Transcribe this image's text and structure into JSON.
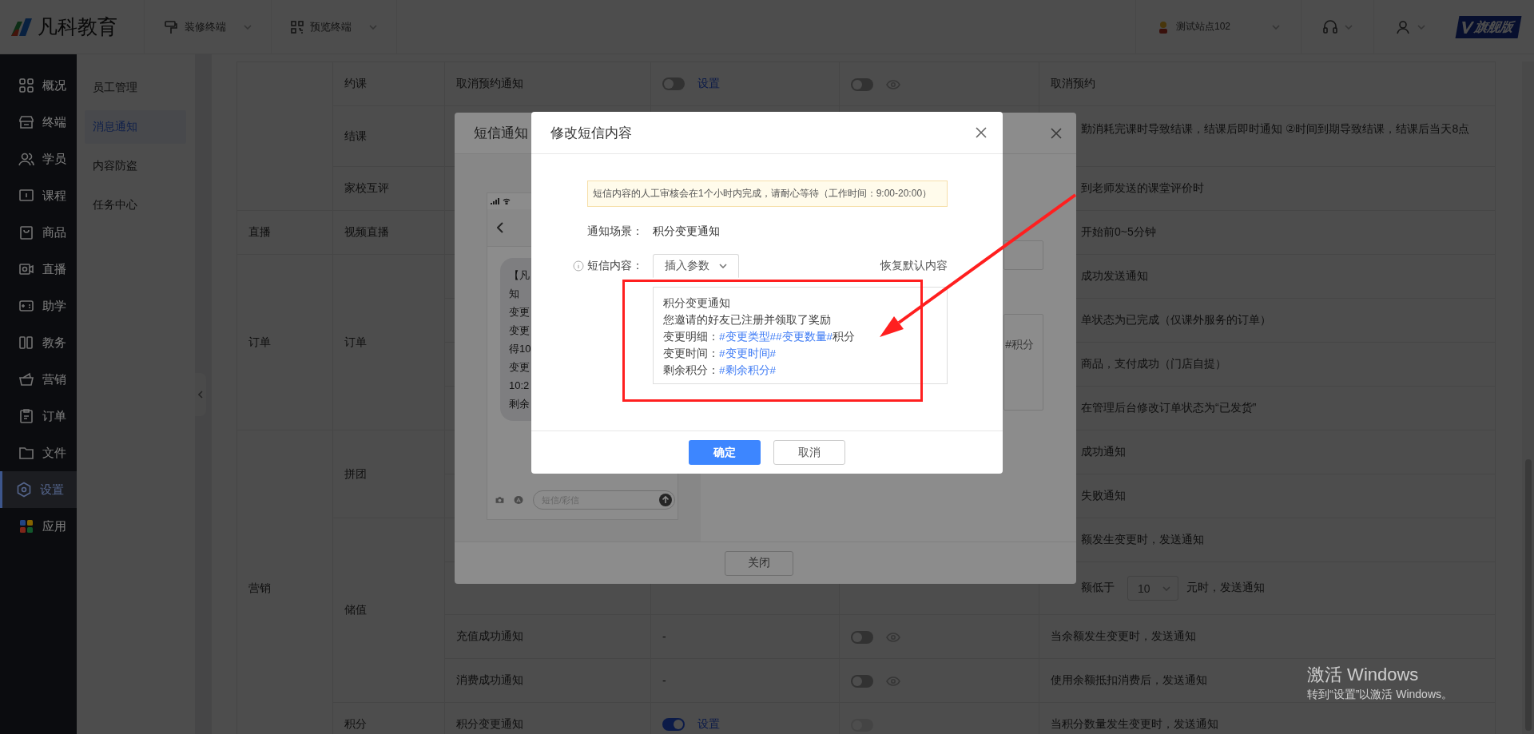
{
  "topbar": {
    "logo_text": "凡科教育",
    "menus": [
      {
        "label": "装修终端"
      },
      {
        "label": "预览终端"
      }
    ],
    "site": "测试站点102",
    "edition": "旗舰版"
  },
  "sidebar": {
    "items": [
      {
        "label": "概况",
        "selected": false
      },
      {
        "label": "终端",
        "selected": false
      },
      {
        "label": "学员",
        "selected": false
      },
      {
        "label": "课程",
        "selected": false
      },
      {
        "label": "商品",
        "selected": false
      },
      {
        "label": "直播",
        "selected": false
      },
      {
        "label": "助学",
        "selected": false
      },
      {
        "label": "教务",
        "selected": false
      },
      {
        "label": "营销",
        "selected": false
      },
      {
        "label": "订单",
        "selected": false
      },
      {
        "label": "文件",
        "selected": false
      },
      {
        "label": "设置",
        "selected": true
      },
      {
        "label": "应用",
        "selected": false
      }
    ]
  },
  "subnav": {
    "items": [
      {
        "label": "员工管理",
        "selected": false
      },
      {
        "label": "消息通知",
        "selected": true
      },
      {
        "label": "内容防盗",
        "selected": false
      },
      {
        "label": "任务中心",
        "selected": false
      }
    ]
  },
  "table": {
    "groups": [
      {
        "subgroups": [
          {
            "name": "约课",
            "rows": [
              {
                "name": "取消预约通知",
                "sms": {
                  "on": false,
                  "link": "设置"
                },
                "wechat": {
                  "on": false,
                  "preview": true
                },
                "description": [
                  {
                    "kind": "text",
                    "text": "取消预约"
                  }
                ]
              }
            ]
          },
          {
            "name": "结课",
            "rows": [
              {
                "description": [
                  {
                    "kind": "wrapped",
                    "text": "勤消耗完课时导致结课，结课后即时通知 ②时间到期导致结课，结课后当天8点"
                  }
                ]
              }
            ]
          },
          {
            "name": "家校互评",
            "rows": [
              {
                "description": [
                  {
                    "kind": "text",
                    "text": "到老师发送的课堂评价时"
                  }
                ]
              }
            ]
          }
        ]
      },
      {
        "category": "直播",
        "subgroups": [
          {
            "name": "视频直播",
            "rows": [
              {
                "description": [
                  {
                    "kind": "text",
                    "text": "开始前0~5分钟"
                  }
                ]
              }
            ]
          }
        ]
      },
      {
        "category": "订单",
        "subgroups": [
          {
            "name": "订单",
            "rows": [
              {
                "description": [
                  {
                    "kind": "text",
                    "text": "成功发送通知"
                  }
                ]
              },
              {
                "description": [
                  {
                    "kind": "text",
                    "text": "单状态为已完成（仅课外服务的订单）"
                  }
                ]
              },
              {
                "description": [
                  {
                    "kind": "text",
                    "text": "商品，支付成功（门店自提）"
                  }
                ]
              },
              {
                "description": [
                  {
                    "kind": "text",
                    "text": "在管理后台修改订单状态为“已发货”"
                  }
                ]
              }
            ]
          }
        ]
      },
      {
        "category": "营销",
        "subgroups": [
          {
            "name": "拼团",
            "rows": [
              {
                "description": [
                  {
                    "kind": "text",
                    "text": "成功通知"
                  }
                ]
              },
              {
                "description": [
                  {
                    "kind": "text",
                    "text": "失败通知"
                  }
                ]
              }
            ]
          },
          {
            "name": "储值",
            "rows": [
              {
                "description": [
                  {
                    "kind": "text",
                    "text": "额发生变更时，发送通知"
                  }
                ]
              },
              {
                "description": [
                  {
                    "kind": "text",
                    "text": "额低于"
                  },
                  {
                    "kind": "select",
                    "value": "10"
                  },
                  {
                    "kind": "text",
                    "text": "元时，发送通知"
                  }
                ]
              },
              {
                "name": "充值成功通知",
                "sms": {
                  "text": "-"
                },
                "wechat": {
                  "on": false,
                  "preview": true
                },
                "description": [
                  {
                    "kind": "text",
                    "text": "当余额发生变更时，发送通知"
                  }
                ]
              },
              {
                "name": "消费成功通知",
                "sms": {
                  "text": "-"
                },
                "wechat": {
                  "on": false,
                  "preview": true
                },
                "description": [
                  {
                    "kind": "text",
                    "text": "使用余额抵扣消费后，发送通知"
                  }
                ]
              }
            ]
          },
          {
            "name": "积分",
            "rows": [
              {
                "name": "积分变更通知",
                "sms": {
                  "on": true,
                  "link": "设置"
                },
                "wechat": {
                  "on": false,
                  "disabled": true
                },
                "description": [
                  {
                    "kind": "text",
                    "text": "当积分数量发生变更时，发送通知"
                  }
                ]
              }
            ]
          }
        ]
      }
    ]
  },
  "sms_settings_dialog": {
    "title": "短信通知",
    "preview_lines": [
      "【凡",
      "知",
      "变更",
      "变更",
      "得10",
      "变更",
      "10:2",
      "剩余"
    ],
    "input_placeholder": "短信/彩信",
    "content_fragment": "#积分",
    "close_button": "关闭"
  },
  "sms_edit_dialog": {
    "title": "修改短信内容",
    "notice": "短信内容的人工审核会在1个小时内完成，请耐心等待（工作时间：9:00-20:00）",
    "scene_label": "通知场景：",
    "scene_value": "积分变更通知",
    "content_label": "短信内容：",
    "insert_button": "插入参数",
    "restore_link": "恢复默认内容",
    "content_lines": [
      [
        {
          "text": "积分变更通知",
          "param": false
        }
      ],
      [
        {
          "text": "您邀请的好友已注册并领取了奖励",
          "param": false
        }
      ],
      [
        {
          "text": "变更明细：",
          "param": false
        },
        {
          "text": "#变更类型##变更数量#",
          "param": true
        },
        {
          "text": "积分",
          "param": false
        }
      ],
      [
        {
          "text": "变更时间：",
          "param": false
        },
        {
          "text": "#变更时间#",
          "param": true
        }
      ],
      [
        {
          "text": "剩余积分：",
          "param": false
        },
        {
          "text": "#剩余积分#",
          "param": true
        }
      ]
    ],
    "buttons": [
      {
        "label": "确定",
        "kind": "primary"
      },
      {
        "label": "取消",
        "kind": "default"
      }
    ]
  },
  "os_watermark": {
    "title": "激活 Windows",
    "subtitle": "转到“设置”以激活 Windows。"
  }
}
